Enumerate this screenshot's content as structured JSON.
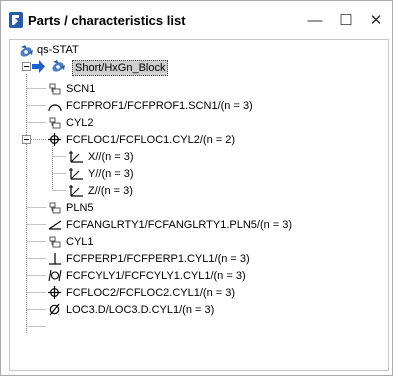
{
  "window": {
    "title": "Parts / characteristics list",
    "controls": {
      "minimize": "—",
      "maximize": "☐",
      "close": "✕"
    }
  },
  "tree": {
    "root": {
      "label": "qs-STAT",
      "icon": "satellite-icon"
    },
    "part": {
      "label": "Short/HxGn_Block",
      "icon": "part-icon",
      "expander": "minus",
      "selected": true
    },
    "items": [
      {
        "label": "SCN1",
        "icon": "datum-feature-icon"
      },
      {
        "label": "FCFPROF1/FCFPROF1.SCN1/(n = 3)",
        "icon": "profile-of-line-icon"
      },
      {
        "label": "CYL2",
        "icon": "datum-feature-icon"
      },
      {
        "label": "FCFLOC1/FCFLOC1.CYL2/(n = 2)",
        "icon": "position-icon",
        "expander": "minus"
      },
      {
        "label": "X//(n = 3)",
        "icon": "axis-icon",
        "child": true
      },
      {
        "label": "Y//(n = 3)",
        "icon": "axis-icon",
        "child": true
      },
      {
        "label": "Z//(n = 3)",
        "icon": "axis-icon",
        "child": true
      },
      {
        "label": "PLN5",
        "icon": "datum-feature-icon"
      },
      {
        "label": "FCFANGLRTY1/FCFANGLRTY1.PLN5/(n = 3)",
        "icon": "angularity-icon"
      },
      {
        "label": "CYL1",
        "icon": "datum-feature-icon"
      },
      {
        "label": "FCFPERP1/FCFPERP1.CYL1/(n = 3)",
        "icon": "perpendicularity-icon"
      },
      {
        "label": "FCFCYLY1/FCFCYLY1.CYL1/(n = 3)",
        "icon": "cylindricity-icon"
      },
      {
        "label": "FCFLOC2/FCFLOC2.CYL1/(n = 3)",
        "icon": "position-icon"
      },
      {
        "label": "LOC3.D/LOC3.D.CYL1/(n = 3)",
        "icon": "diameter-icon"
      }
    ]
  }
}
